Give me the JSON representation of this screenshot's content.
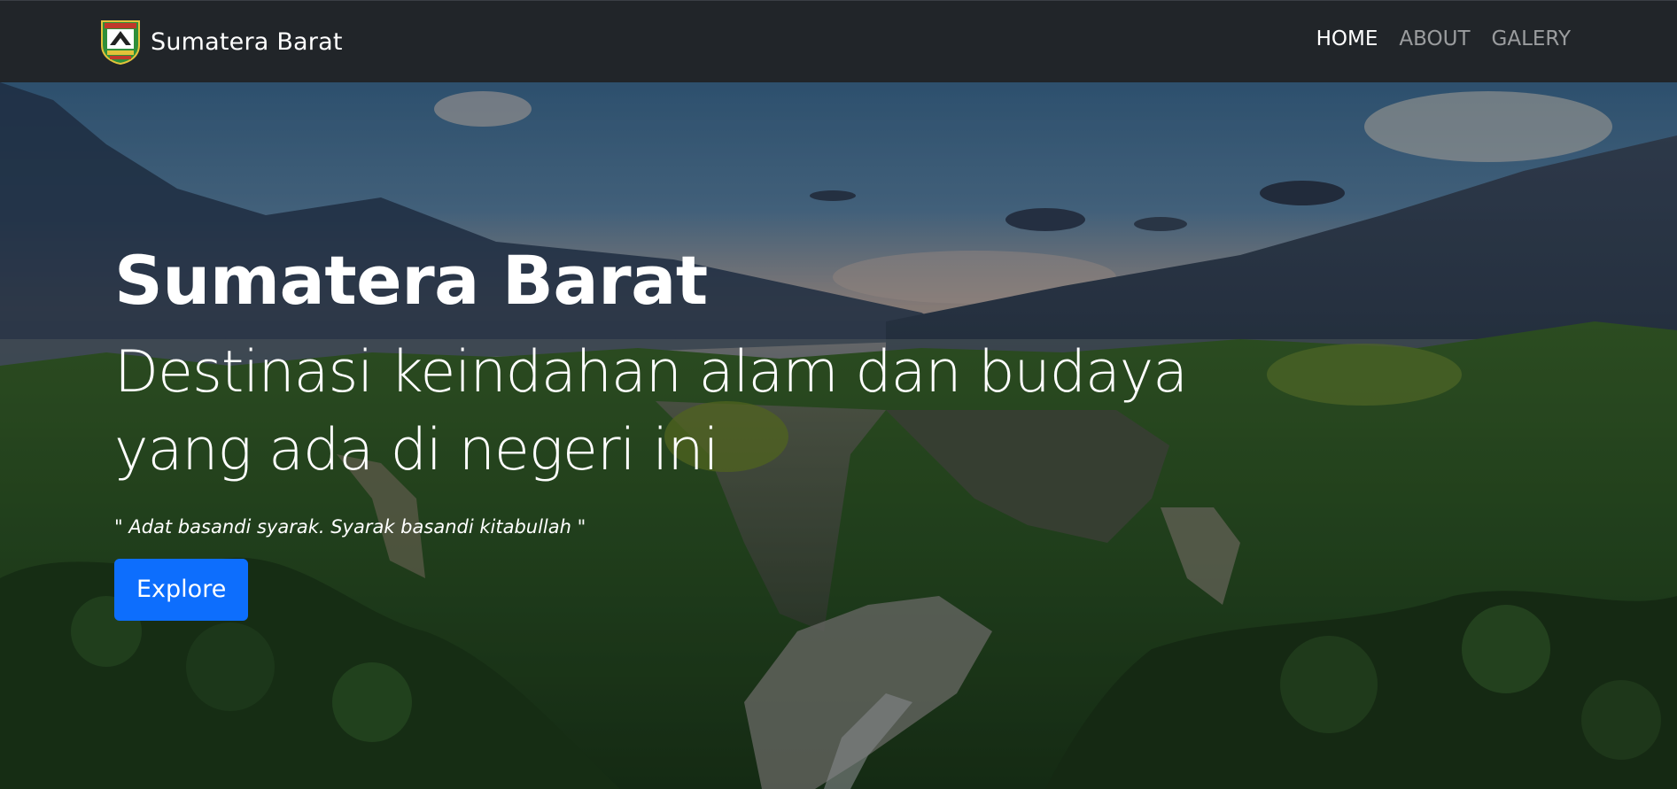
{
  "navbar": {
    "brand": "Sumatera Barat",
    "logo_icon": "sumatera-barat-emblem",
    "items": [
      {
        "label": "HOME",
        "active": true
      },
      {
        "label": "ABOUT",
        "active": false
      },
      {
        "label": "GALERY",
        "active": false
      }
    ]
  },
  "hero": {
    "title": "Sumatera Barat",
    "subtitle": "Destinasi keindahan alam dan budaya yang ada di negeri ini",
    "quote": "\" Adat basandi syarak. Syarak basandi kitabullah \"",
    "button_label": "Explore"
  },
  "colors": {
    "navbar_bg": "#212529",
    "button_bg": "#0d6efd",
    "text": "#ffffff"
  }
}
